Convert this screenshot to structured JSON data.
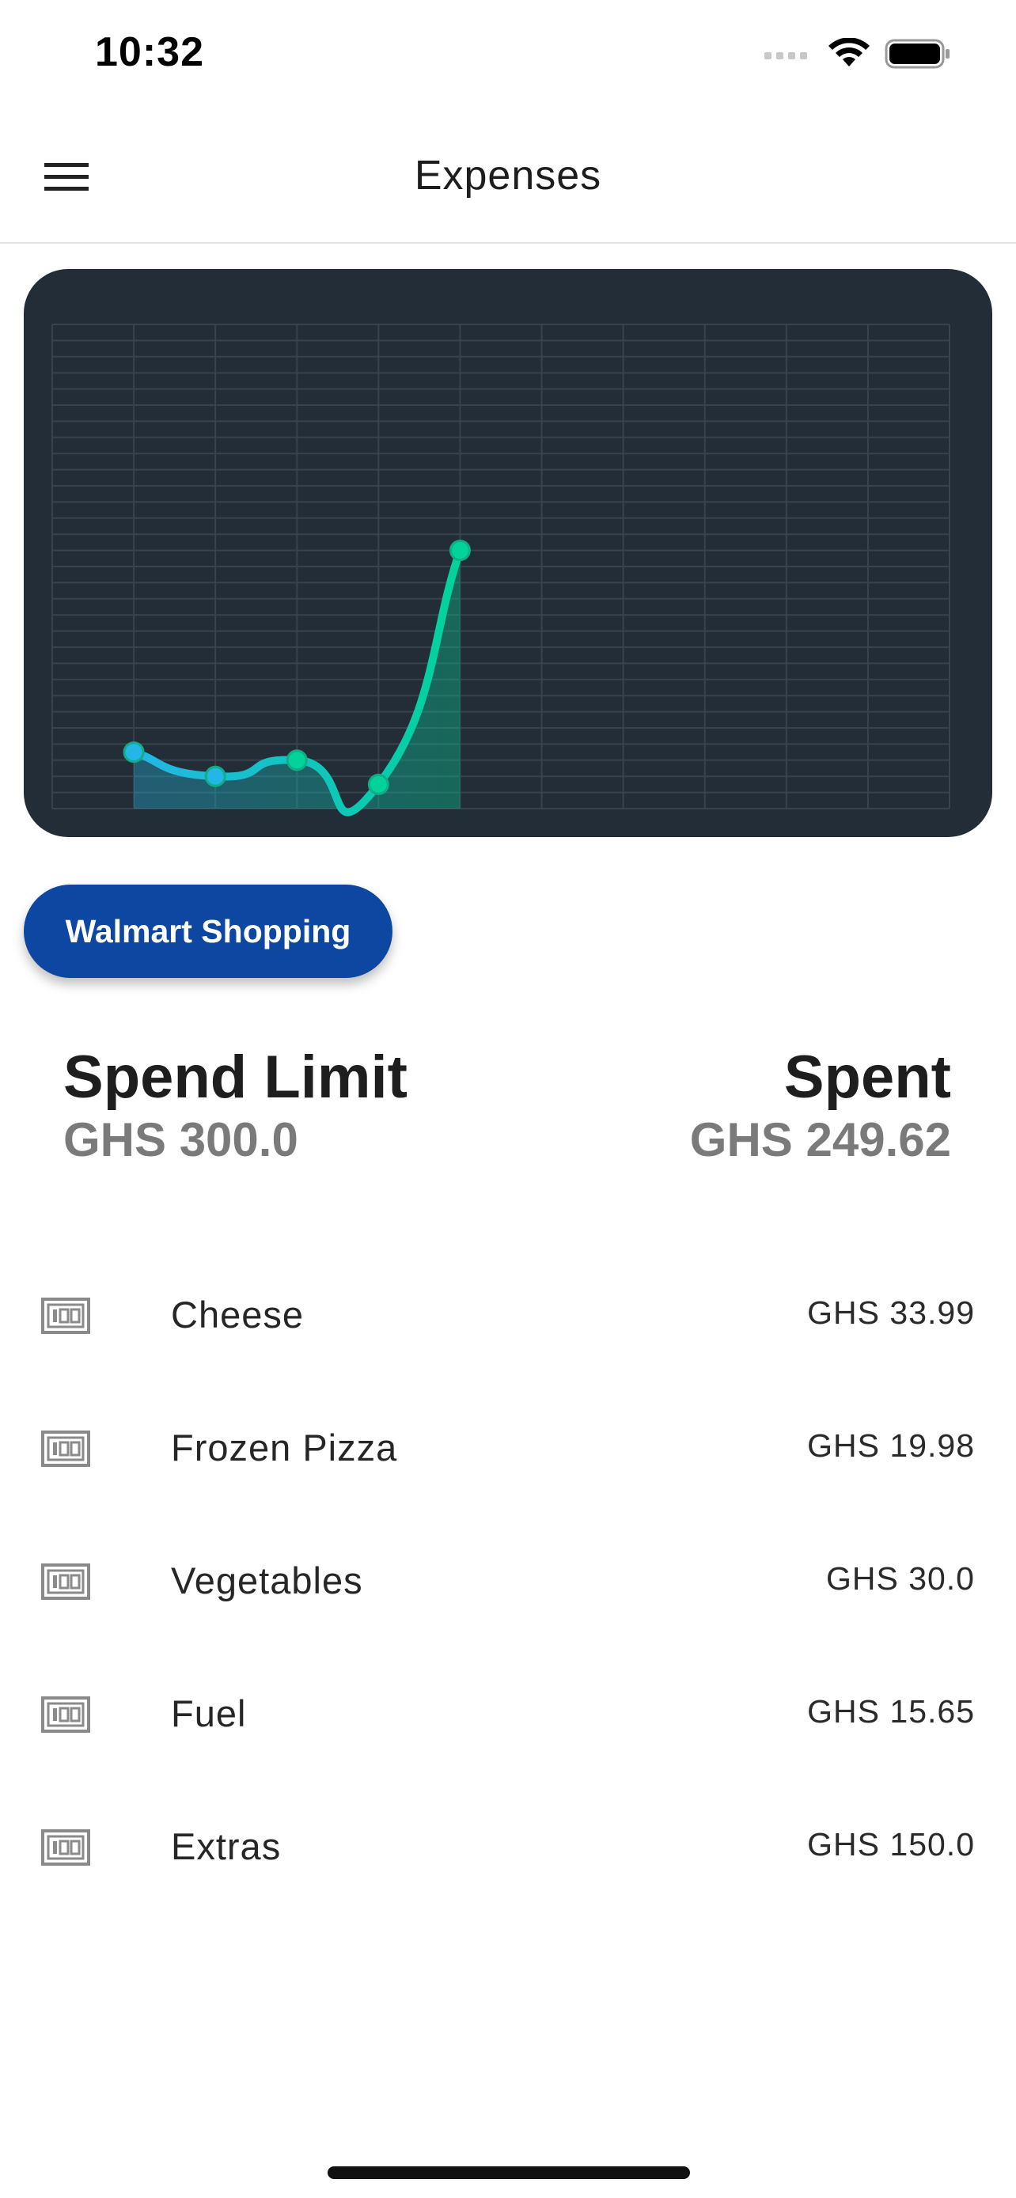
{
  "status_bar": {
    "time": "10:32"
  },
  "app_bar": {
    "title": "Expenses",
    "menu_icon": "hamburger-menu-icon"
  },
  "chart_data": {
    "type": "line",
    "x": [
      1,
      2,
      3,
      4,
      5
    ],
    "values": [
      0.7,
      0.4,
      0.6,
      0.3,
      3.2
    ],
    "xlim": [
      0,
      11
    ],
    "ylim": [
      0,
      6
    ],
    "grid": true,
    "colors": {
      "background": "#232d37",
      "grid": "#37434d",
      "line_start": "#23b6e6",
      "line_end": "#02d39a"
    }
  },
  "chip": {
    "label": "Walmart Shopping",
    "color": "#0d47a1"
  },
  "summary": {
    "limit_label": "Spend Limit",
    "limit_value": "GHS 300.0",
    "spent_label": "Spent",
    "spent_value": "GHS 249.62"
  },
  "expenses": [
    {
      "name": "Cheese",
      "amount": "GHS 33.99",
      "icon": "money-100-icon"
    },
    {
      "name": "Frozen Pizza",
      "amount": "GHS 19.98",
      "icon": "money-100-icon"
    },
    {
      "name": "Vegetables",
      "amount": "GHS 30.0",
      "icon": "money-100-icon"
    },
    {
      "name": "Fuel",
      "amount": "GHS 15.65",
      "icon": "money-100-icon"
    },
    {
      "name": "Extras",
      "amount": "GHS 150.0",
      "icon": "money-100-icon"
    }
  ]
}
